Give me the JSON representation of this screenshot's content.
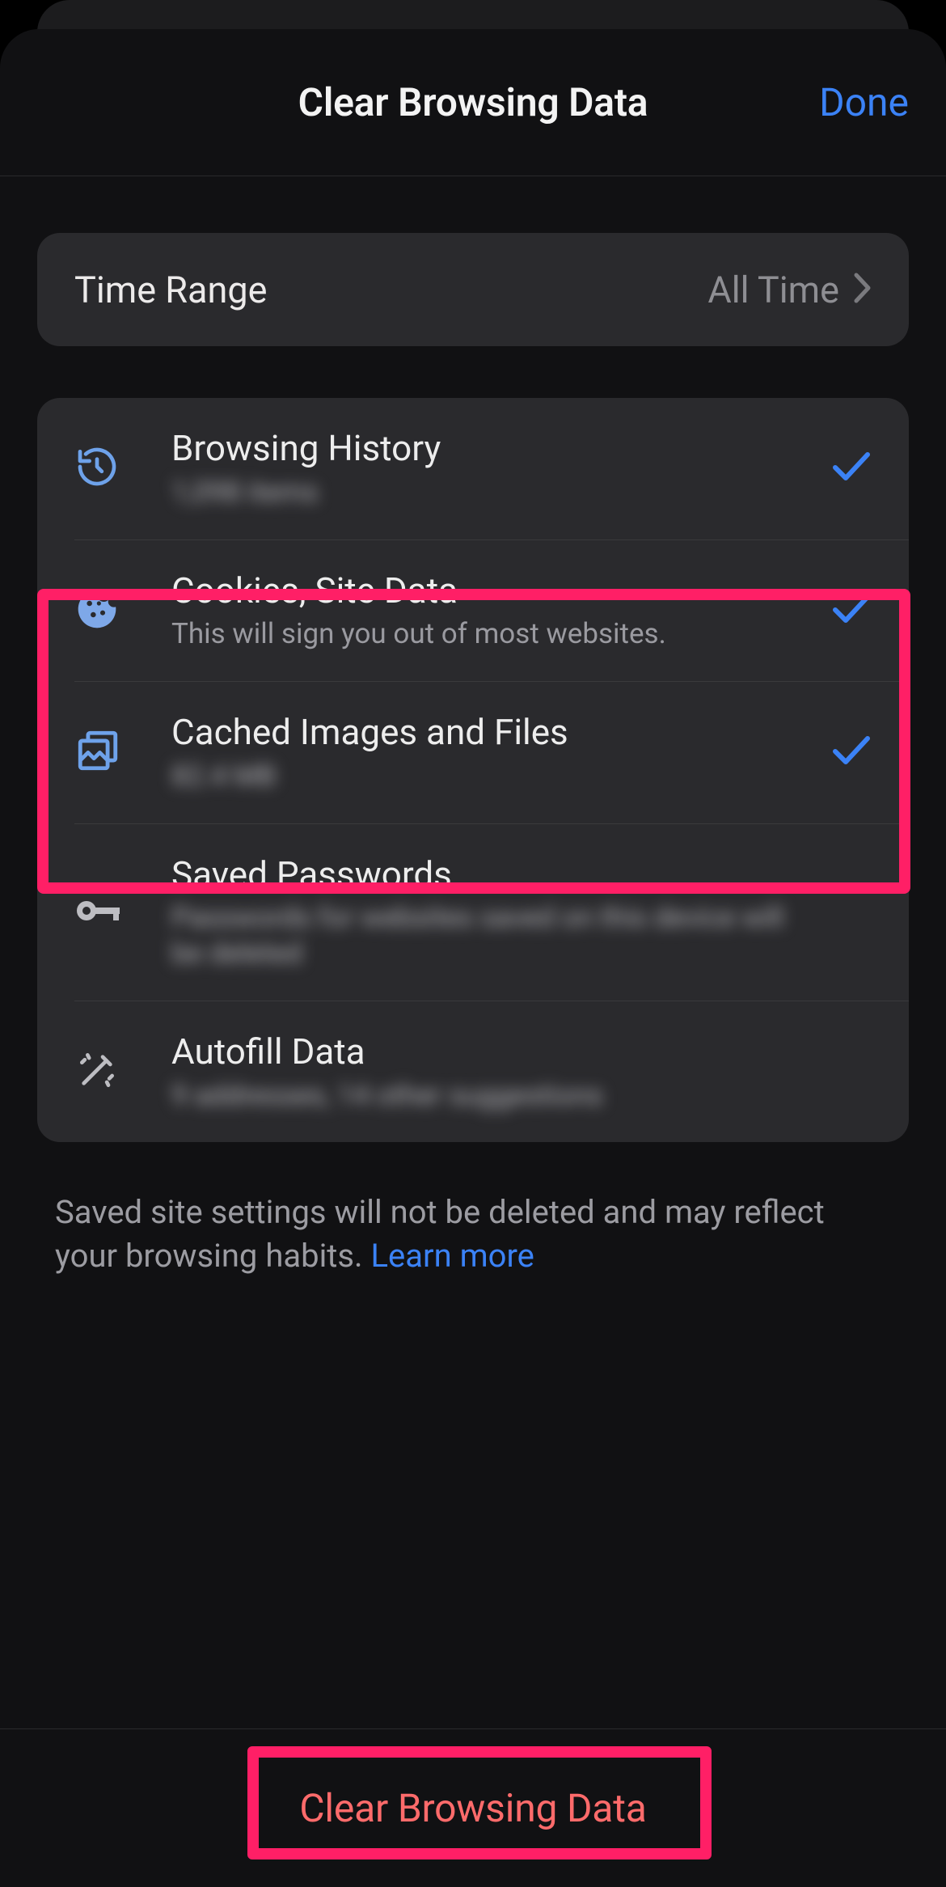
{
  "header": {
    "title": "Clear Browsing Data",
    "done": "Done"
  },
  "timeRange": {
    "label": "Time Range",
    "value": "All Time"
  },
  "items": [
    {
      "title": "Browsing History",
      "sub": "1,098 items",
      "checked": true,
      "blurSub": true,
      "icon": "history-icon"
    },
    {
      "title": "Cookies, Site Data",
      "sub": "This will sign you out of most websites.",
      "checked": true,
      "blurSub": false,
      "icon": "cookie-icon"
    },
    {
      "title": "Cached Images and Files",
      "sub": "82.4 MB",
      "checked": true,
      "blurSub": true,
      "icon": "images-icon"
    },
    {
      "title": "Saved Passwords",
      "sub": "Passwords for websites saved on this device will be deleted",
      "checked": false,
      "blurSub": true,
      "icon": "key-icon"
    },
    {
      "title": "Autofill Data",
      "sub": "9 addresses, 14 other suggestions",
      "checked": false,
      "blurSub": true,
      "icon": "wand-icon"
    }
  ],
  "footnote": {
    "text": "Saved site settings will not be deleted and may reflect your browsing habits. ",
    "link": "Learn more"
  },
  "footer": {
    "button": "Clear Browsing Data"
  },
  "colors": {
    "accent": "#3b82f6",
    "highlight": "#ff1f66",
    "danger": "#ff6b6b"
  }
}
